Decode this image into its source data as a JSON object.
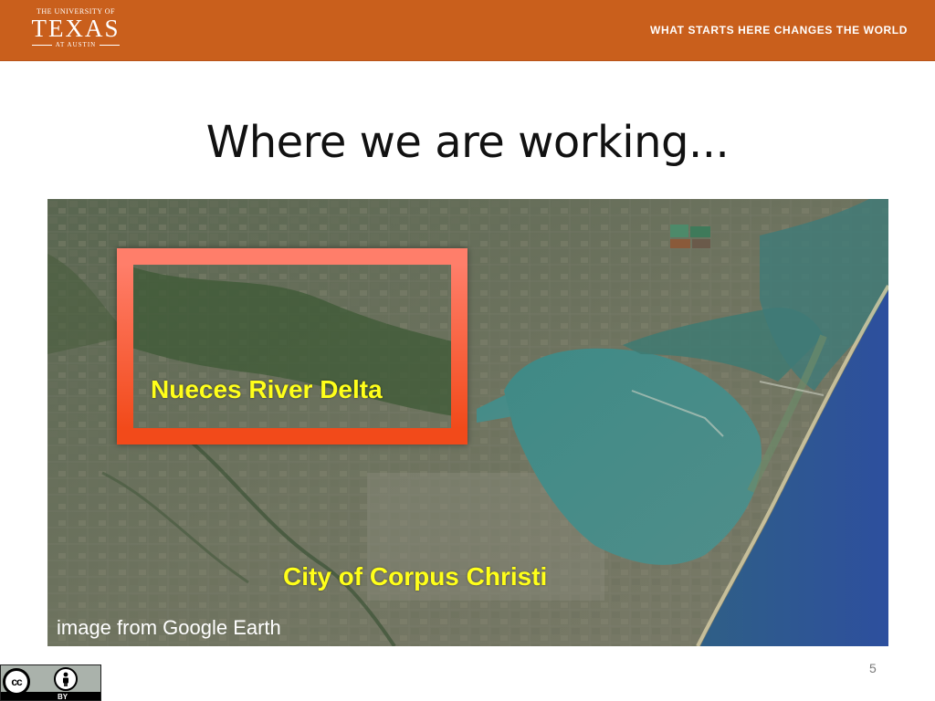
{
  "header": {
    "logo_line1": "THE UNIVERSITY OF",
    "logo_line2": "TEXAS",
    "logo_line3": "AT AUSTIN",
    "tagline": "WHAT STARTS HERE CHANGES THE WORLD",
    "background_color": "#c95f1c"
  },
  "slide": {
    "title": "Where we are working...",
    "page_number": "5"
  },
  "map": {
    "labels": {
      "nueces": "Nueces River Delta",
      "corpus": "City of Corpus Christi"
    },
    "credit": "image from Google Earth",
    "highlight_color": "#f25a30",
    "label_color": "#ffff1a"
  },
  "license": {
    "cc_label": "cc",
    "by_label": "BY"
  }
}
